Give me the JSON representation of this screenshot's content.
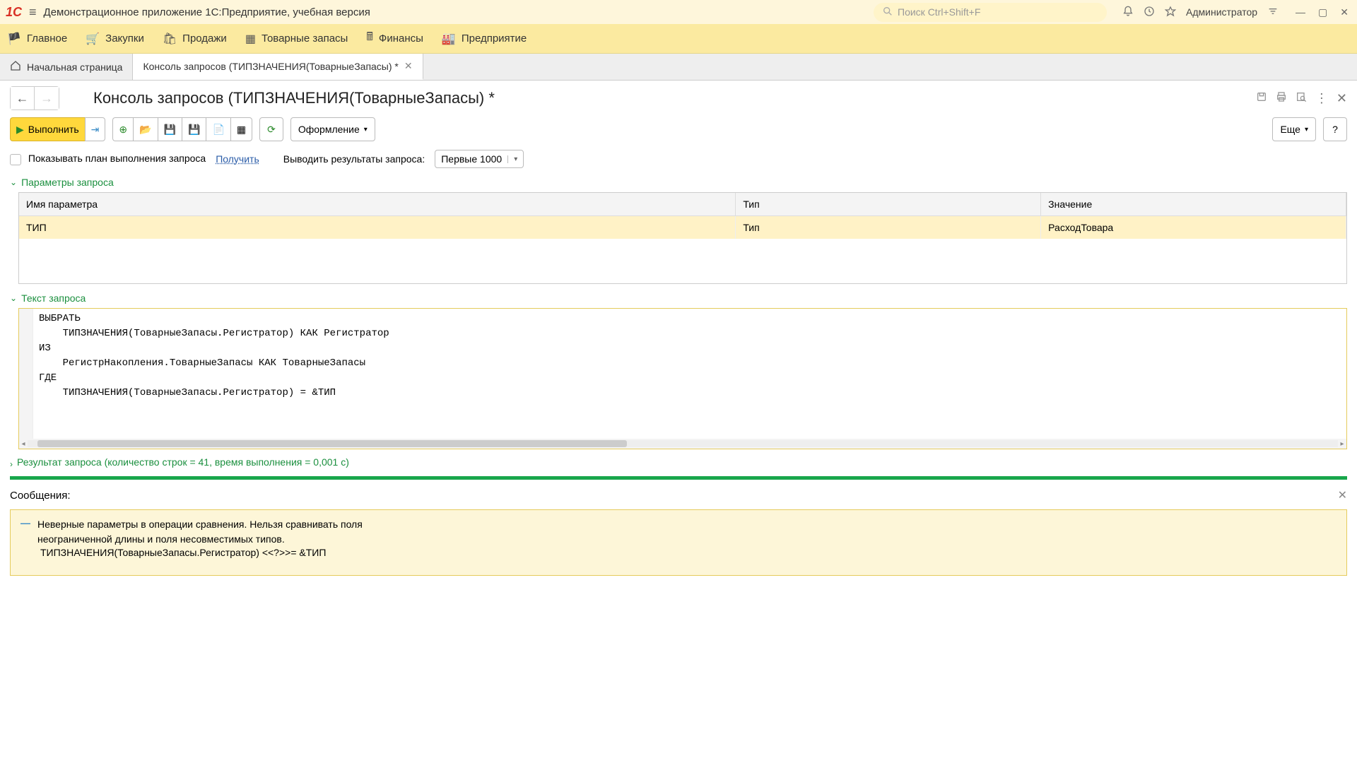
{
  "title_bar": {
    "app_title": "Демонстрационное приложение 1С:Предприятие, учебная версия",
    "search_placeholder": "Поиск Ctrl+Shift+F",
    "user": "Администратор"
  },
  "main_nav": {
    "items": [
      {
        "label": "Главное"
      },
      {
        "label": "Закупки"
      },
      {
        "label": "Продажи"
      },
      {
        "label": "Товарные запасы"
      },
      {
        "label": "Финансы"
      },
      {
        "label": "Предприятие"
      }
    ]
  },
  "tabs": {
    "home": "Начальная страница",
    "active": "Консоль запросов (ТИПЗНАЧЕНИЯ(ТоварныеЗапасы) *"
  },
  "page": {
    "title": "Консоль запросов (ТИПЗНАЧЕНИЯ(ТоварныеЗапасы) *"
  },
  "toolbar": {
    "execute": "Выполнить",
    "format": "Оформление",
    "more": "Еще",
    "help": "?"
  },
  "options": {
    "show_plan": "Показывать план выполнения запроса",
    "get_link": "Получить",
    "results_label": "Выводить результаты запроса:",
    "results_value": "Первые 1000"
  },
  "sections": {
    "params": "Параметры запроса",
    "query": "Текст запроса",
    "result": "Результат запроса (количество строк = 41, время выполнения = 0,001 с)"
  },
  "params_table": {
    "headers": {
      "name": "Имя параметра",
      "type": "Тип",
      "value": "Значение"
    },
    "rows": [
      {
        "name": "ТИП",
        "type": "Тип",
        "value": "РасходТовара"
      }
    ]
  },
  "query_text": "ВЫБРАТЬ\n    ТИПЗНАЧЕНИЯ(ТоварныеЗапасы.Регистратор) КАК Регистратор\nИЗ\n    РегистрНакопления.ТоварныеЗапасы КАК ТоварныеЗапасы\nГДЕ\n    ТИПЗНАЧЕНИЯ(ТоварныеЗапасы.Регистратор) = &ТИП",
  "messages": {
    "title": "Сообщения:",
    "line1": "Неверные параметры в операции сравнения. Нельзя сравнивать поля",
    "line2": "неограниченной длины и поля несовместимых типов.",
    "line3": "ТИПЗНАЧЕНИЯ(ТоварныеЗапасы.Регистратор) <<?>>= &ТИП"
  }
}
